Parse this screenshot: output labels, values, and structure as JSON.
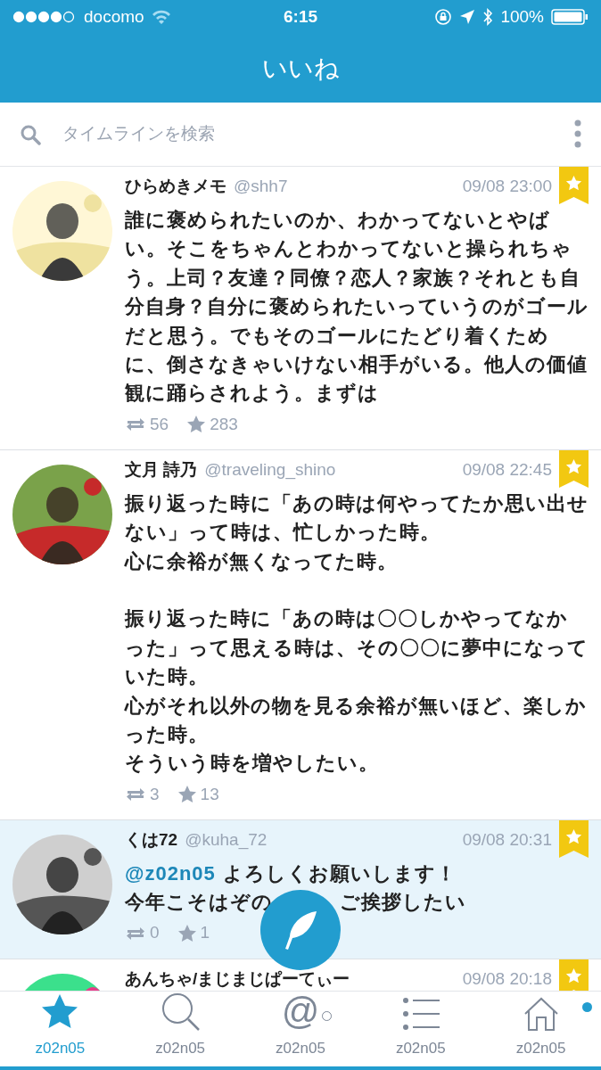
{
  "status_bar": {
    "carrier": "docomo",
    "time": "6:15",
    "battery": "100%"
  },
  "nav": {
    "title": "いいね"
  },
  "search": {
    "placeholder": "タイムラインを検索"
  },
  "tweets": [
    {
      "name": "ひらめきメモ",
      "handle": "@shh7",
      "time": "09/08 23:00",
      "paragraphs": [
        [
          {
            "text": "誰に褒められたいのか、わかってないとやばい。そこをちゃんとわかってないと操られちゃう。上司？友達？同僚？恋人？家族？それとも自分自身？自分に褒められたいっていうのがゴールだと思う。でもそのゴールにたどり着くために、倒さなきゃいけない相手がいる。他人の価値観に踊らされよう。まずは"
          }
        ]
      ],
      "retweets": "56",
      "likes": "283",
      "favorited": true,
      "highlighted": false,
      "avatar": {
        "kind": "picture"
      }
    },
    {
      "name": "文月 詩乃",
      "handle": "@traveling_shino",
      "time": "09/08 22:45",
      "paragraphs": [
        [
          {
            "text": "振り返った時に「あの時は何やってたか思い出せない」って時は、忙しかった時。"
          },
          {
            "text": "心に余裕が無くなってた時。"
          }
        ],
        [
          {
            "text": "振り返った時に「あの時は〇〇しかやってなかった」って思える時は、その〇〇に夢中になっていた時。"
          },
          {
            "text": "心がそれ以外の物を見る余裕が無いほど、楽しかった時。"
          },
          {
            "text": "そういう時を増やしたい。"
          }
        ]
      ],
      "retweets": "3",
      "likes": "13",
      "favorited": true,
      "highlighted": false,
      "avatar": {
        "kind": "picture"
      }
    },
    {
      "name": "くは72",
      "handle": "@kuha_72",
      "time": "09/08 20:31",
      "paragraphs": [
        [
          {
            "mention": "@z02n05",
            "text": "よろしくお願いします！"
          },
          {
            "text": "今年こそはぞの",
            "after_cover": "ご挨拶したい"
          }
        ]
      ],
      "retweets": "0",
      "likes": "1",
      "favorited": true,
      "highlighted": true,
      "avatar": {
        "kind": "picture"
      }
    },
    {
      "name": "あんちゃ/まじまじぱーてぃー",
      "time": "09/08 20:18",
      "favorited": true,
      "highlighted": false,
      "avatar": {
        "kind": "picture"
      }
    }
  ],
  "tab_bar": [
    {
      "kind": "star",
      "label": "z02n05",
      "selected": true,
      "unread": false
    },
    {
      "kind": "search",
      "label": "z02n05",
      "selected": false,
      "unread": false
    },
    {
      "kind": "mention",
      "glyph": "@",
      "label": "z02n05",
      "selected": false,
      "unread": true,
      "unread_filled": false
    },
    {
      "kind": "list",
      "label": "z02n05",
      "selected": false,
      "unread": false
    },
    {
      "kind": "home",
      "label": "z02n05",
      "selected": false,
      "unread": true,
      "unread_filled": true
    }
  ]
}
